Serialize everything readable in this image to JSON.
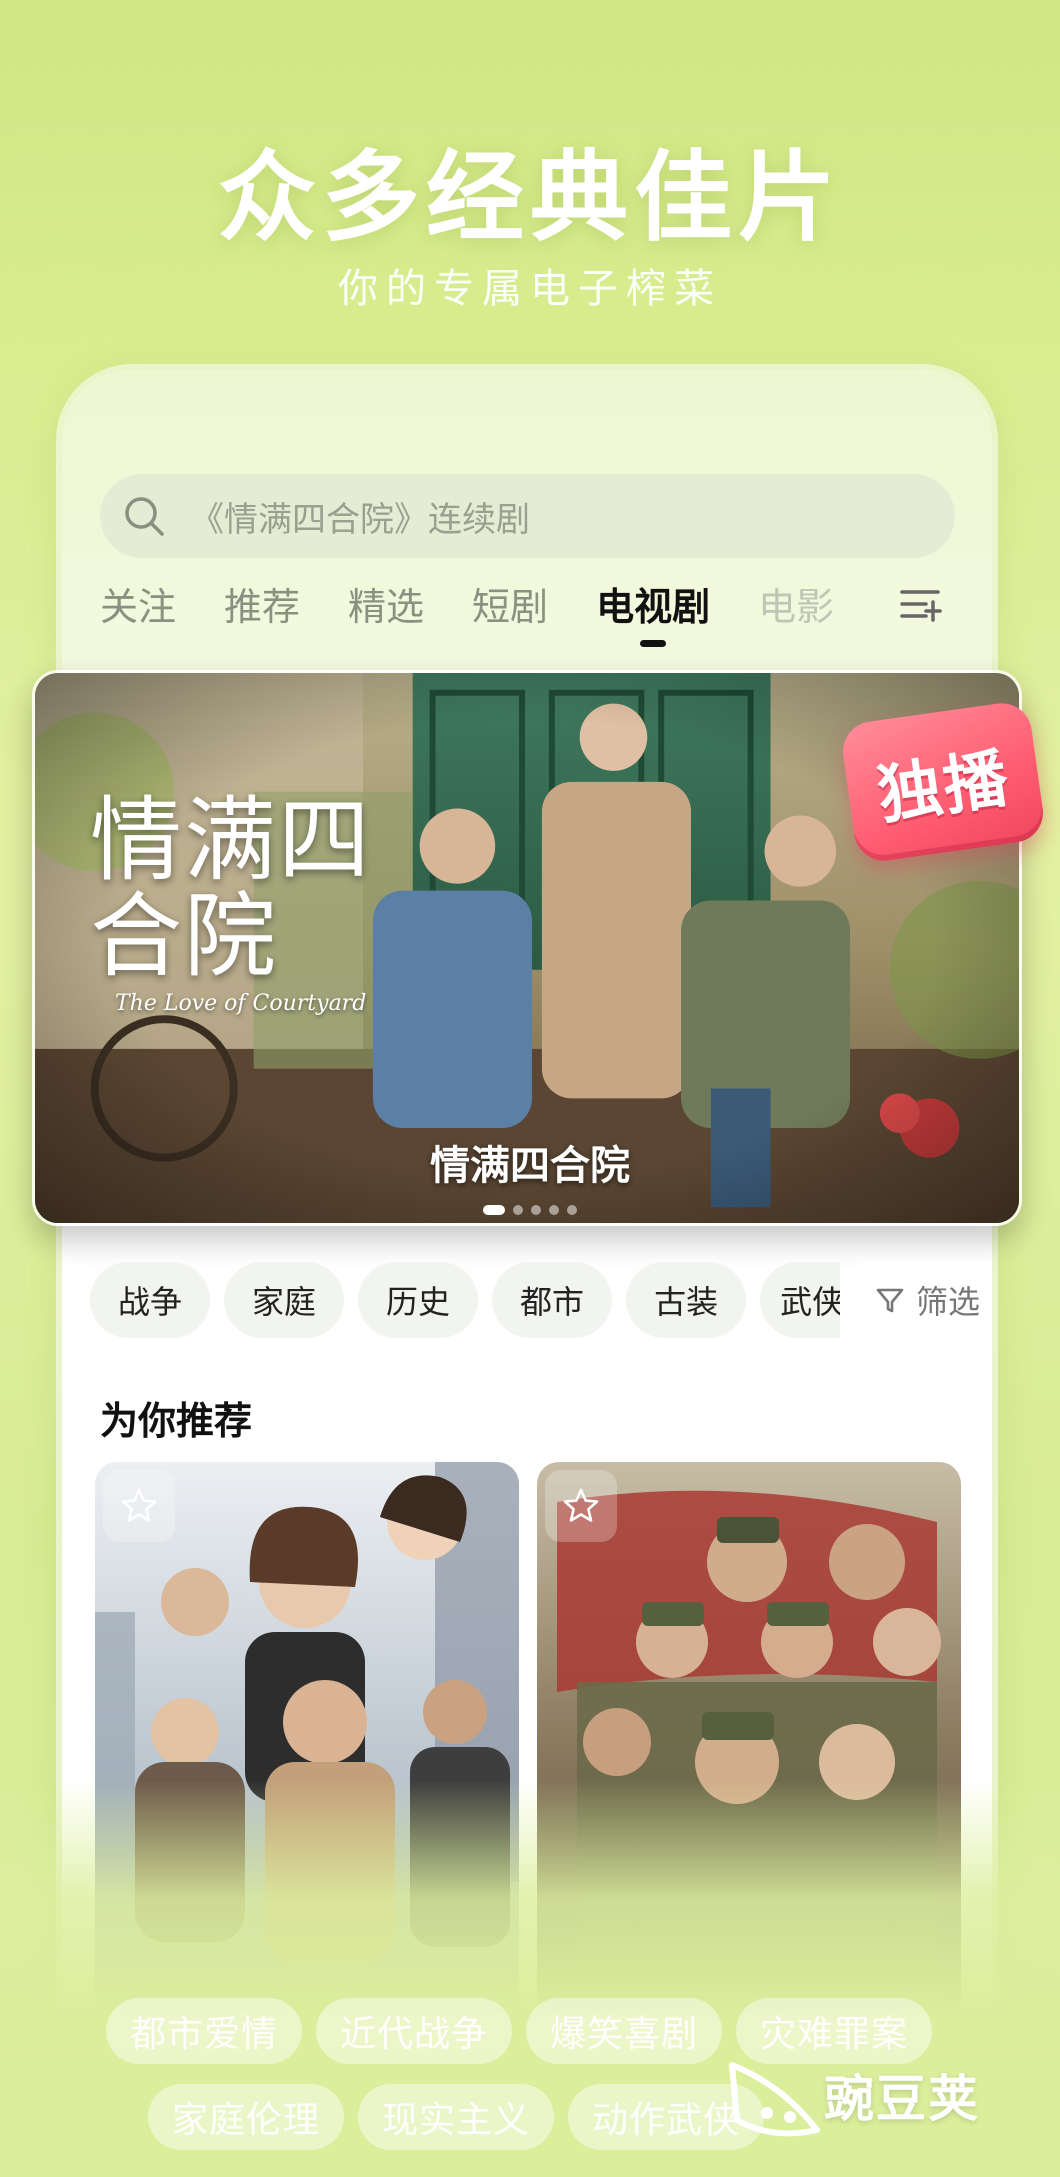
{
  "promo": {
    "title": "众多经典佳片",
    "subtitle": "你的专属电子榨菜"
  },
  "search": {
    "icon": "search-icon",
    "placeholder": "《情满四合院》连续剧"
  },
  "tabs": [
    {
      "label": "关注"
    },
    {
      "label": "推荐"
    },
    {
      "label": "精选"
    },
    {
      "label": "短剧"
    },
    {
      "label": "电视剧",
      "active": true
    },
    {
      "label": "电影"
    }
  ],
  "tabs_menu_icon": "channel-menu-icon",
  "banner": {
    "logo_cn": "情满四合院",
    "logo_en": "The Love of Courtyard",
    "caption": "情满四合院",
    "badge": "独播",
    "badge_color": "#ff5d72",
    "dots": 5,
    "active_dot": 0
  },
  "genres": [
    "战争",
    "家庭",
    "历史",
    "都市",
    "古装",
    "武侠"
  ],
  "filter": {
    "label": "筛选",
    "icon": "filter-icon"
  },
  "recommend": {
    "title": "为你推荐",
    "cards": [
      {
        "icon": "star-icon"
      },
      {
        "icon": "star-icon"
      }
    ]
  },
  "tags": {
    "row1": [
      "都市爱情",
      "近代战争",
      "爆笑喜剧",
      "灾难罪案"
    ],
    "row2": [
      "家庭伦理",
      "现实主义",
      "动作武侠"
    ]
  },
  "watermark": {
    "text": "豌豆荚"
  },
  "colors": {
    "background": "#d8ec8e",
    "accent": "#111111",
    "badge": "#ff5d72"
  }
}
